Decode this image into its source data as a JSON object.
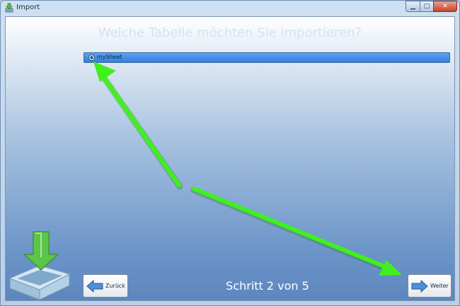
{
  "window": {
    "title": "Import",
    "app_icon": "import-app-icon",
    "controls": {
      "minimize_icon": "minimize-icon",
      "maximize_icon": "maximize-icon",
      "close_icon": "close-icon"
    }
  },
  "main": {
    "question": "Welche Tabelle möchten Sie importieren?",
    "sheets": [
      {
        "label": "mySheet",
        "selected": true
      }
    ],
    "step_text": "Schritt 2 von 5",
    "illustration_icon": "import-tray-icon"
  },
  "buttons": {
    "back_label": "Zurück",
    "back_icon": "arrow-left-icon",
    "next_label": "Weiter",
    "next_icon": "arrow-right-icon"
  },
  "colors": {
    "selection": "#3d87e8",
    "annotation_arrow": "#36e81c",
    "step_text": "#ffffff"
  }
}
